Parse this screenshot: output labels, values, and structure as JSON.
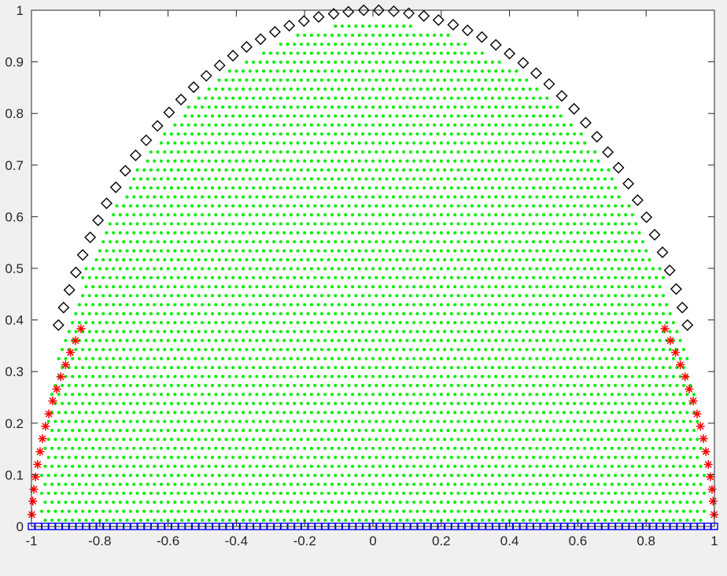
{
  "chart_data": {
    "type": "scatter",
    "title": "",
    "xlabel": "",
    "ylabel": "",
    "xlim": [
      -1,
      1
    ],
    "ylim": [
      0,
      1
    ],
    "grid": false,
    "legend": "none",
    "x_ticks": [
      -1,
      -0.8,
      -0.6,
      -0.4,
      -0.2,
      0,
      0.2,
      0.4,
      0.6,
      0.8,
      1
    ],
    "x_tick_labels": [
      "-1",
      "-0.8",
      "-0.6",
      "-0.4",
      "-0.2",
      "0",
      "0.2",
      "0.4",
      "0.6",
      "0.8",
      "1"
    ],
    "y_ticks": [
      0,
      0.1,
      0.2,
      0.3,
      0.4,
      0.5,
      0.6,
      0.7,
      0.8,
      0.9,
      1
    ],
    "y_tick_labels": [
      "0",
      "0.1",
      "0.2",
      "0.3",
      "0.4",
      "0.5",
      "0.6",
      "0.7",
      "0.8",
      "0.9",
      "1"
    ],
    "series": [
      {
        "marker": "square",
        "color": "#0000ff",
        "points": [
          [
            -1,
            0
          ],
          [
            -0.98,
            0
          ],
          [
            -0.96,
            0
          ],
          [
            -0.94,
            0
          ],
          [
            -0.92,
            0
          ],
          [
            -0.9,
            0
          ],
          [
            -0.88,
            0
          ],
          [
            -0.86,
            0
          ],
          [
            -0.84,
            0
          ],
          [
            -0.82,
            0
          ],
          [
            -0.8,
            0
          ],
          [
            -0.78,
            0
          ],
          [
            -0.76,
            0
          ],
          [
            -0.74,
            0
          ],
          [
            -0.72,
            0
          ],
          [
            -0.7,
            0
          ],
          [
            -0.68,
            0
          ],
          [
            -0.66,
            0
          ],
          [
            -0.64,
            0
          ],
          [
            -0.62,
            0
          ],
          [
            -0.6,
            0
          ],
          [
            -0.58,
            0
          ],
          [
            -0.56,
            0
          ],
          [
            -0.54,
            0
          ],
          [
            -0.52,
            0
          ],
          [
            -0.5,
            0
          ],
          [
            -0.48,
            0
          ],
          [
            -0.46,
            0
          ],
          [
            -0.44,
            0
          ],
          [
            -0.42,
            0
          ],
          [
            -0.4,
            0
          ],
          [
            -0.38,
            0
          ],
          [
            -0.36,
            0
          ],
          [
            -0.34,
            0
          ],
          [
            -0.32,
            0
          ],
          [
            -0.3,
            0
          ],
          [
            -0.28,
            0
          ],
          [
            -0.26,
            0
          ],
          [
            -0.24,
            0
          ],
          [
            -0.22,
            0
          ],
          [
            -0.2,
            0
          ],
          [
            -0.18,
            0
          ],
          [
            -0.16,
            0
          ],
          [
            -0.14,
            0
          ],
          [
            -0.12,
            0
          ],
          [
            -0.1,
            0
          ],
          [
            -0.08,
            0
          ],
          [
            -0.06,
            0
          ],
          [
            -0.04,
            0
          ],
          [
            -0.02,
            0
          ],
          [
            0,
            0
          ],
          [
            0.02,
            0
          ],
          [
            0.04,
            0
          ],
          [
            0.06,
            0
          ],
          [
            0.08,
            0
          ],
          [
            0.1,
            0
          ],
          [
            0.12,
            0
          ],
          [
            0.14,
            0
          ],
          [
            0.16,
            0
          ],
          [
            0.18,
            0
          ],
          [
            0.2,
            0
          ],
          [
            0.22,
            0
          ],
          [
            0.24,
            0
          ],
          [
            0.26,
            0
          ],
          [
            0.28,
            0
          ],
          [
            0.3,
            0
          ],
          [
            0.32,
            0
          ],
          [
            0.34,
            0
          ],
          [
            0.36,
            0
          ],
          [
            0.38,
            0
          ],
          [
            0.4,
            0
          ],
          [
            0.42,
            0
          ],
          [
            0.44,
            0
          ],
          [
            0.46,
            0
          ],
          [
            0.48,
            0
          ],
          [
            0.5,
            0
          ],
          [
            0.52,
            0
          ],
          [
            0.54,
            0
          ],
          [
            0.56,
            0
          ],
          [
            0.58,
            0
          ],
          [
            0.6,
            0
          ],
          [
            0.62,
            0
          ],
          [
            0.64,
            0
          ],
          [
            0.66,
            0
          ],
          [
            0.68,
            0
          ],
          [
            0.7,
            0
          ],
          [
            0.72,
            0
          ],
          [
            0.74,
            0
          ],
          [
            0.76,
            0
          ],
          [
            0.78,
            0
          ],
          [
            0.8,
            0
          ],
          [
            0.82,
            0
          ],
          [
            0.84,
            0
          ],
          [
            0.86,
            0
          ],
          [
            0.88,
            0
          ],
          [
            0.9,
            0
          ],
          [
            0.92,
            0
          ],
          [
            0.94,
            0
          ],
          [
            0.96,
            0
          ],
          [
            0.98,
            0
          ],
          [
            1,
            0
          ]
        ]
      },
      {
        "marker": "asterisk",
        "color": "#ff0000",
        "points": [
          [
            -0.999,
            0.023
          ],
          [
            -0.996,
            0.049
          ],
          [
            -0.993,
            0.072
          ],
          [
            -0.988,
            0.096
          ],
          [
            -0.982,
            0.12
          ],
          [
            -0.975,
            0.145
          ],
          [
            -0.968,
            0.17
          ],
          [
            -0.959,
            0.194
          ],
          [
            -0.949,
            0.218
          ],
          [
            -0.938,
            0.243
          ],
          [
            -0.926,
            0.266
          ],
          [
            -0.914,
            0.29
          ],
          [
            -0.9,
            0.313
          ],
          [
            -0.886,
            0.337
          ],
          [
            -0.871,
            0.36
          ],
          [
            -0.855,
            0.383
          ],
          [
            0.855,
            0.383
          ],
          [
            0.871,
            0.36
          ],
          [
            0.886,
            0.337
          ],
          [
            0.9,
            0.313
          ],
          [
            0.914,
            0.29
          ],
          [
            0.926,
            0.266
          ],
          [
            0.938,
            0.243
          ],
          [
            0.949,
            0.218
          ],
          [
            0.959,
            0.194
          ],
          [
            0.968,
            0.17
          ],
          [
            0.975,
            0.145
          ],
          [
            0.982,
            0.12
          ],
          [
            0.988,
            0.096
          ],
          [
            0.993,
            0.072
          ],
          [
            0.996,
            0.049
          ],
          [
            0.999,
            0.023
          ]
        ]
      },
      {
        "marker": "diamond",
        "color": "#000000",
        "points": [
          [
            -0.921,
            0.39
          ],
          [
            -0.906,
            0.424
          ],
          [
            -0.889,
            0.458
          ],
          [
            -0.87,
            0.492
          ],
          [
            -0.85,
            0.526
          ],
          [
            -0.828,
            0.56
          ],
          [
            -0.805,
            0.593
          ],
          [
            -0.78,
            0.626
          ],
          [
            -0.753,
            0.657
          ],
          [
            -0.725,
            0.689
          ],
          [
            -0.695,
            0.719
          ],
          [
            -0.664,
            0.748
          ],
          [
            -0.631,
            0.776
          ],
          [
            -0.597,
            0.802
          ],
          [
            -0.562,
            0.827
          ],
          [
            -0.525,
            0.851
          ],
          [
            -0.488,
            0.873
          ],
          [
            -0.449,
            0.893
          ],
          [
            -0.41,
            0.912
          ],
          [
            -0.37,
            0.929
          ],
          [
            -0.329,
            0.944
          ],
          [
            -0.287,
            0.958
          ],
          [
            -0.245,
            0.97
          ],
          [
            -0.202,
            0.979
          ],
          [
            -0.159,
            0.987
          ],
          [
            -0.115,
            0.993
          ],
          [
            -0.072,
            0.997
          ],
          [
            -0.027,
            1
          ],
          [
            0.017,
            1
          ],
          [
            0.061,
            0.998
          ],
          [
            0.105,
            0.994
          ],
          [
            0.149,
            0.989
          ],
          [
            0.192,
            0.981
          ],
          [
            0.235,
            0.972
          ],
          [
            0.277,
            0.961
          ],
          [
            0.319,
            0.948
          ],
          [
            0.36,
            0.933
          ],
          [
            0.4,
            0.916
          ],
          [
            0.44,
            0.898
          ],
          [
            0.478,
            0.878
          ],
          [
            0.516,
            0.857
          ],
          [
            0.553,
            0.834
          ],
          [
            0.589,
            0.809
          ],
          [
            0.623,
            0.782
          ],
          [
            0.656,
            0.755
          ],
          [
            0.688,
            0.725
          ],
          [
            0.719,
            0.695
          ],
          [
            0.748,
            0.664
          ],
          [
            0.775,
            0.632
          ],
          [
            0.801,
            0.599
          ],
          [
            0.825,
            0.565
          ],
          [
            0.848,
            0.531
          ],
          [
            0.869,
            0.496
          ],
          [
            0.888,
            0.46
          ],
          [
            0.906,
            0.424
          ],
          [
            0.921,
            0.39
          ]
        ]
      },
      {
        "marker": "point",
        "color": "#00ee00",
        "generator": "interior points of the half-disk x^2+y^2<1, y>0, spacing about 0.02"
      }
    ]
  }
}
